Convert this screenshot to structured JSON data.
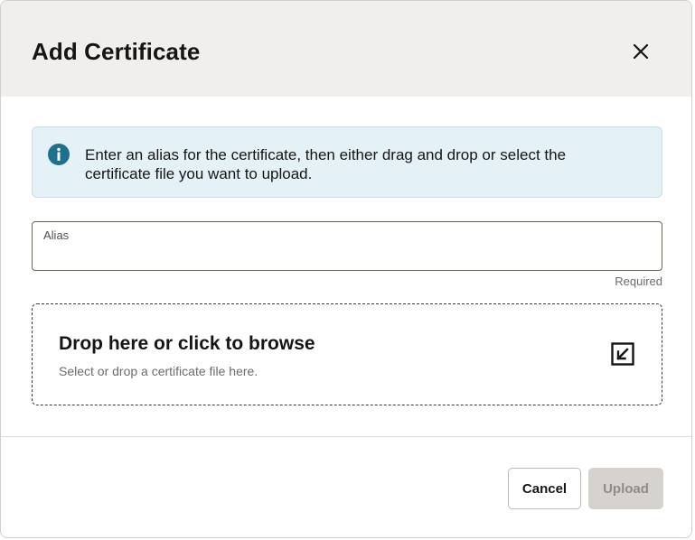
{
  "dialog": {
    "title": "Add Certificate",
    "close_icon": "close-icon"
  },
  "info": {
    "icon": "info-icon",
    "message": "Enter an alias for the certificate, then either drag and drop or select the certificate file you want to upload.",
    "color": "#1f6f8f"
  },
  "alias": {
    "label": "Alias",
    "value": "",
    "placeholder": "",
    "helper": "Required"
  },
  "dropzone": {
    "title": "Drop here or click to browse",
    "subtitle": "Select or drop a certificate file here.",
    "icon": "upload-arrow-icon"
  },
  "footer": {
    "cancel_label": "Cancel",
    "upload_label": "Upload",
    "upload_disabled": true
  }
}
